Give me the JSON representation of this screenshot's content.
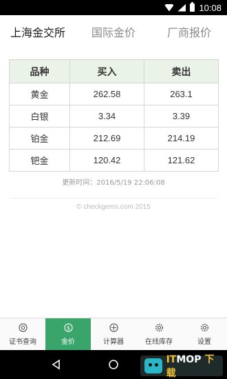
{
  "status_bar": {
    "time": "10:08",
    "icons": [
      "wifi-icon",
      "signal-icon",
      "battery-icon"
    ]
  },
  "tabs": [
    {
      "label": "上海金交所",
      "active": true
    },
    {
      "label": "国际金价",
      "active": false
    },
    {
      "label": "厂商报价",
      "active": false
    }
  ],
  "table": {
    "headers": [
      "品种",
      "买入",
      "卖出"
    ],
    "rows": [
      {
        "name": "黄金",
        "buy": "262.58",
        "sell": "263.1"
      },
      {
        "name": "白银",
        "buy": "3.34",
        "sell": "3.39"
      },
      {
        "name": "铂金",
        "buy": "212.69",
        "sell": "214.19"
      },
      {
        "name": "钯金",
        "buy": "120.42",
        "sell": "121.62"
      }
    ]
  },
  "update_time": "更新时间：2016/5/19 22:06:08",
  "copyright": "© checkgems.com 2015",
  "bottom_nav": [
    {
      "label": "证书查询",
      "icon": "certificate-icon",
      "active": false
    },
    {
      "label": "金价",
      "icon": "dollar-icon",
      "active": true
    },
    {
      "label": "计算器",
      "icon": "calculator-icon",
      "active": false
    },
    {
      "label": "在线库存",
      "icon": "gear-icon",
      "active": false
    },
    {
      "label": "设置",
      "icon": "gear-icon",
      "active": false
    }
  ],
  "system_nav": [
    "back-icon",
    "home-icon",
    "recents-icon"
  ],
  "watermark": {
    "text_part1": "IT",
    "text_part2": "MOP",
    "suffix": "下载"
  },
  "colors": {
    "accent": "#3aa56a",
    "header_bg": "#ebf3e9",
    "status_bar": "#000000"
  }
}
